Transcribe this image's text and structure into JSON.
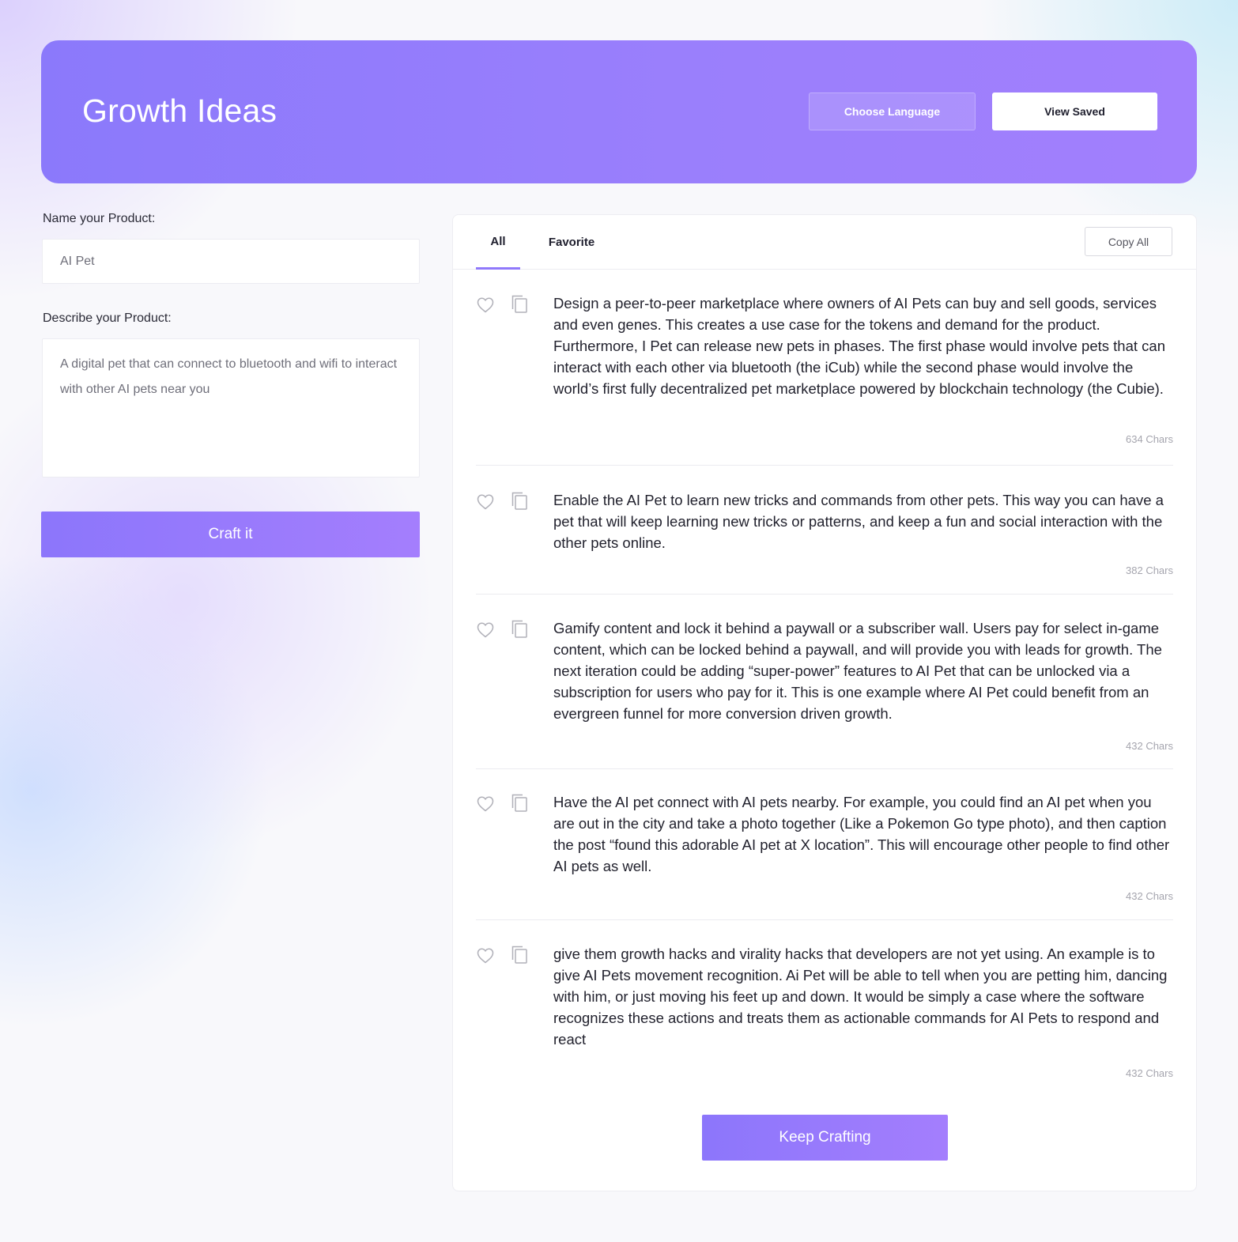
{
  "header": {
    "title": "Growth Ideas",
    "choose_language_label": "Choose Language",
    "view_saved_label": "View Saved"
  },
  "form": {
    "name_label": "Name your Product:",
    "name_value": "AI Pet",
    "describe_label": "Describe your Product:",
    "describe_value": "A digital pet that can connect to bluetooth and wifi to interact with other AI pets near you",
    "craft_label": "Craft it"
  },
  "results": {
    "tabs": [
      {
        "label": "All",
        "active": true
      },
      {
        "label": "Favorite",
        "active": false
      }
    ],
    "copy_all_label": "Copy All",
    "ideas": [
      {
        "text": "Design a peer-to-peer marketplace where owners of AI Pets can buy and sell goods, services and even genes. This creates a use case for the tokens and demand for the product. Furthermore, I Pet can release new pets in phases. The first phase would involve pets that can interact with each other via bluetooth (the iCub) while the second phase would involve the world’s first fully decentralized pet marketplace powered by blockchain technology (the Cubie).",
        "chars": "634 Chars"
      },
      {
        "text": "Enable the AI Pet to learn new tricks and commands from other pets. This way you can have a pet that will keep learning new tricks or patterns, and keep a fun and social interaction with the other pets online.",
        "chars": "382 Chars"
      },
      {
        "text": "Gamify content and lock it behind a paywall or a subscriber wall. Users pay for select in-game content, which can be locked behind a paywall, and will provide you with leads for growth. The next iteration could be adding “super-power” features to AI Pet that can be unlocked via a subscription for users who pay for it. This is one example where AI Pet could benefit from an evergreen funnel for more conversion driven growth.",
        "chars": "432 Chars"
      },
      {
        "text": "Have the AI pet connect with AI pets nearby. For example, you could find an AI pet when you are out in the city and take a photo together (Like a Pokemon Go type photo), and then caption the post “found this adorable AI pet at X location”. This will encourage other people to find other AI pets as well.",
        "chars": "432 Chars"
      },
      {
        "text": "give them growth hacks and virality hacks that developers are not yet using. An example is to give AI Pets movement recognition. Ai Pet will be able to tell when you are petting him, dancing with him, or just moving his feet up and down. It would be simply a case where the software recognizes these actions and treats them as actionable commands for AI Pets to respond and react",
        "chars": "432 Chars"
      }
    ],
    "keep_crafting_label": "Keep Crafting"
  },
  "icons": {
    "favorite": "heart-outline-icon",
    "copy": "copy-icon"
  },
  "colors": {
    "accent": "#9079fb",
    "header_gradient_start": "#8b79fb",
    "header_gradient_end": "#a27ffd"
  }
}
